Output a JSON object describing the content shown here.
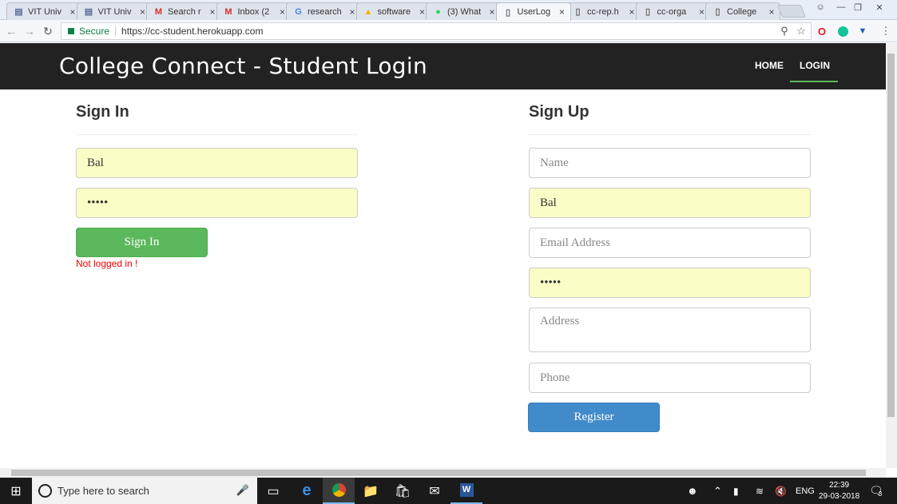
{
  "browser": {
    "tabs": [
      {
        "label": "VIT Univ",
        "icon": "vit-icon",
        "color": "#5b6f9b"
      },
      {
        "label": "VIT Univ",
        "icon": "vit-icon",
        "color": "#5b6f9b"
      },
      {
        "label": "Search r",
        "icon": "gmail-icon",
        "color": "#d93025"
      },
      {
        "label": "Inbox (2",
        "icon": "gmail-icon",
        "color": "#d93025"
      },
      {
        "label": "research",
        "icon": "google-icon",
        "color": "#4285f4"
      },
      {
        "label": "software",
        "icon": "drive-icon",
        "color": "#f4b400"
      },
      {
        "label": "(3) What",
        "icon": "whatsapp-icon",
        "color": "#25d366"
      },
      {
        "label": "UserLog",
        "icon": "page-icon",
        "color": "#666666"
      },
      {
        "label": "cc-rep.h",
        "icon": "page-icon",
        "color": "#666666"
      },
      {
        "label": "cc-orga",
        "icon": "page-icon",
        "color": "#666666"
      },
      {
        "label": "College",
        "icon": "page-icon",
        "color": "#666666"
      }
    ],
    "active_tab_index": 7,
    "secure_label": "Secure",
    "url": "https://cc-student.herokuapp.com"
  },
  "header": {
    "brand": "College Connect - Student Login",
    "nav": {
      "home": "HOME",
      "login": "LOGIN"
    }
  },
  "signin": {
    "title": "Sign In",
    "username_value": "Bal",
    "password_value": "•••••",
    "button_label": "Sign In",
    "error_text": "Not logged in !"
  },
  "signup": {
    "title": "Sign Up",
    "name_placeholder": "Name",
    "username_value": "Bal",
    "email_placeholder": "Email Address",
    "password_value": "•••••",
    "address_placeholder": "Address",
    "phone_placeholder": "Phone",
    "button_label": "Register"
  },
  "taskbar": {
    "search_placeholder": "Type here to search",
    "language": "ENG",
    "time": "22:39",
    "date": "29-03-2018",
    "notifications": "3"
  },
  "colors": {
    "header_bg": "#222222",
    "signin_button": "#5cb85c",
    "register_button": "#428bca",
    "autofill": "#fafec6",
    "error": "#ee0000"
  }
}
